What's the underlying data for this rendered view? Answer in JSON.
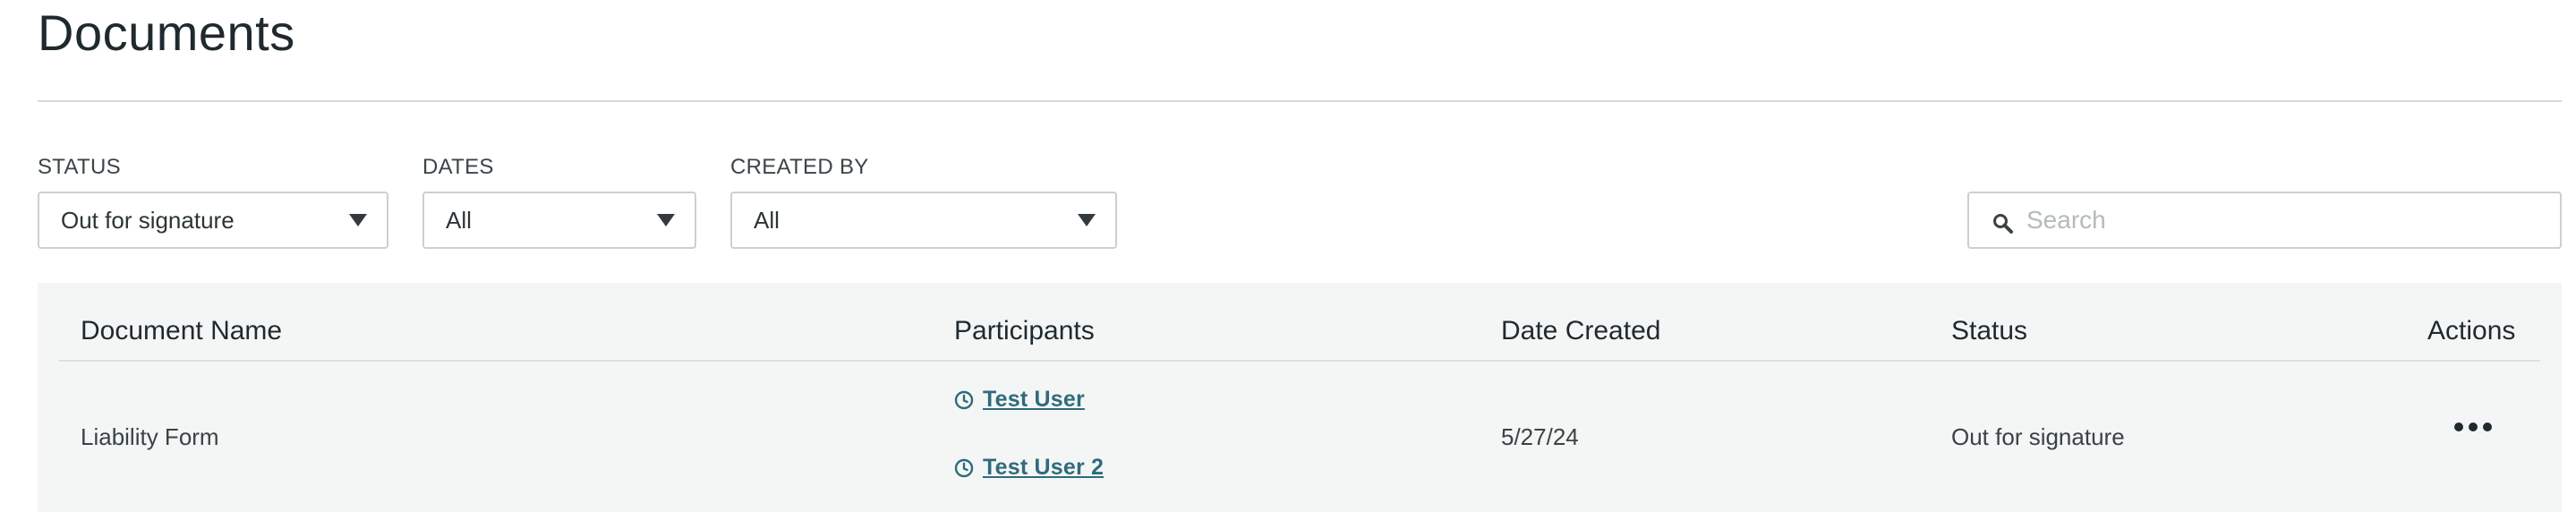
{
  "page": {
    "title": "Documents"
  },
  "filters": {
    "status": {
      "label": "STATUS",
      "value": "Out for signature"
    },
    "dates": {
      "label": "DATES",
      "value": "All"
    },
    "created_by": {
      "label": "CREATED BY",
      "value": "All"
    }
  },
  "search": {
    "placeholder": "Search",
    "value": ""
  },
  "table": {
    "headers": {
      "document_name": "Document Name",
      "participants": "Participants",
      "date_created": "Date Created",
      "status": "Status",
      "actions": "Actions"
    },
    "rows": [
      {
        "document_name": "Liability Form",
        "participants": [
          "Test User",
          "Test User 2"
        ],
        "date_created": "5/27/24",
        "status": "Out for signature",
        "actions_icon": "more-horizontal-icon"
      }
    ]
  },
  "colors": {
    "accent_link": "#2f6b7c",
    "table_bg": "#f4f6f6",
    "text_primary": "#1f2a2e"
  }
}
